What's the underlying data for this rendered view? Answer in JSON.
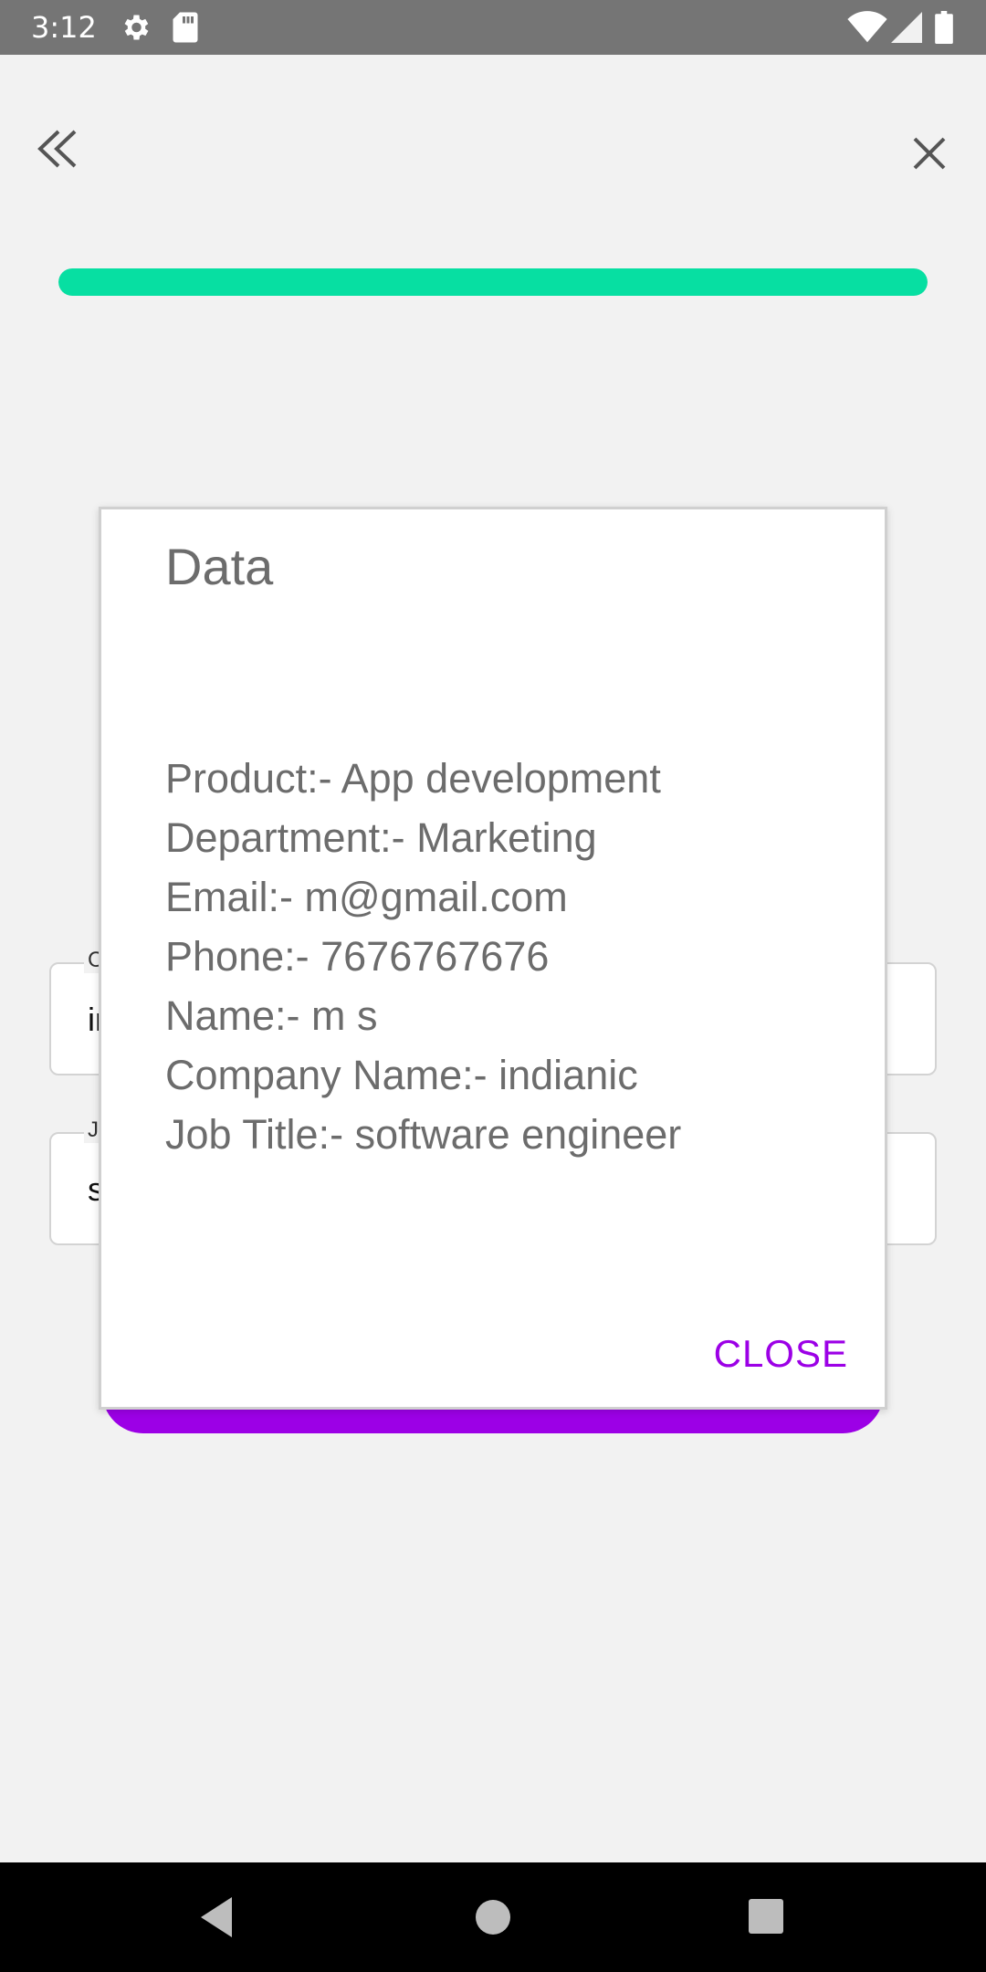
{
  "status_bar": {
    "time": "3:12",
    "icons": [
      "gear-icon",
      "sd-card-icon",
      "wifi-icon",
      "signal-icon",
      "battery-icon"
    ]
  },
  "header": {
    "back_icon": "double-chevron-left-icon",
    "close_icon": "close-icon"
  },
  "progress": {
    "value": 1.0,
    "color": "#07dfa2"
  },
  "form": {
    "fields": [
      {
        "label": "C",
        "value": "in"
      },
      {
        "label": "J",
        "value": "s"
      }
    ],
    "submit_color": "#9c00e6"
  },
  "dialog": {
    "title": "Data",
    "lines": [
      "Product:- App development",
      "Department:- Marketing",
      "Email:- m@gmail.com",
      "Phone:- 7676767676",
      "Name:- m s",
      "Company Name:- indianic",
      "Job Title:- software engineer"
    ],
    "close_label": "CLOSE",
    "accent": "#9c00e6"
  },
  "nav_bar": {
    "icons": [
      "nav-back-icon",
      "nav-home-icon",
      "nav-recents-icon"
    ]
  }
}
